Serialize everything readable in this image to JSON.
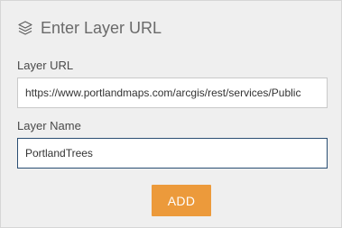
{
  "dialog": {
    "title": "Enter Layer URL",
    "header_icon": "layers-icon"
  },
  "form": {
    "url_label": "Layer URL",
    "url_value": "https://www.portlandmaps.com/arcgis/rest/services/Public",
    "name_label": "Layer Name",
    "name_value": "PortlandTrees",
    "submit_label": "ADD"
  },
  "colors": {
    "panel_background": "#efefef",
    "accent_button": "#ec9a3b",
    "focused_border": "#2a4e73"
  }
}
